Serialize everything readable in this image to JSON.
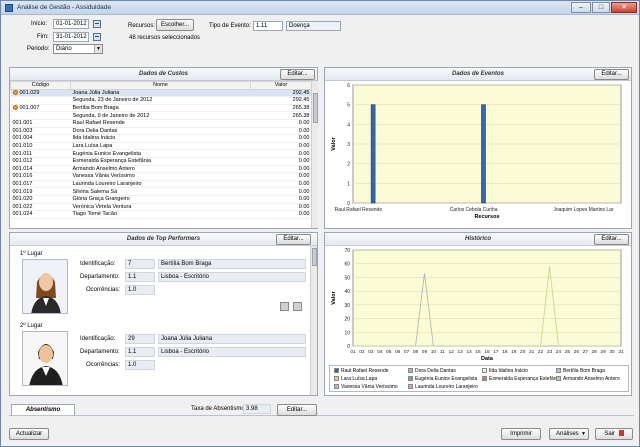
{
  "window": {
    "title": "Análise de Gestão - Assiduidade"
  },
  "filters": {
    "inicio_label": "Início:",
    "inicio_value": "01-01-2012",
    "fim_label": "Fim:",
    "fim_value": "31-01-2012",
    "periodo_label": "Periodo:",
    "periodo_value": "Diário",
    "recursos_label": "Recursos:",
    "escolher_label": "Escolher...",
    "recursos_status": "48 recursos seleccionados",
    "tipo_evento_label": "Tipo de Evento:",
    "tipo_evento_code": "1.11",
    "tipo_evento_name": "Doença"
  },
  "custos": {
    "title": "Dados de Custos",
    "edit_label": "Editar...",
    "columns": [
      "Código",
      "Nome",
      "Valor"
    ],
    "rows": [
      {
        "code": "001.029",
        "name": "Joana Júlia Juliana",
        "value": "292.45",
        "group": true
      },
      {
        "code": "",
        "name": "Segunda, 23 de Janeiro de 2012",
        "value": "292.45",
        "group": false
      },
      {
        "code": "001.007",
        "name": "Bertília Bom Braga",
        "value": "265.38",
        "group": true
      },
      {
        "code": "",
        "name": "Segunda, 9 de Janeiro de 2012",
        "value": "265.38",
        "group": false
      },
      {
        "code": "001.001",
        "name": "Raul Rafael Resende",
        "value": "0.00",
        "group": false
      },
      {
        "code": "001.003",
        "name": "Dora Delia Dantas",
        "value": "0.00",
        "group": false
      },
      {
        "code": "001.004",
        "name": "Ilda Idalina Inácio",
        "value": "0.00",
        "group": false
      },
      {
        "code": "001.010",
        "name": "Lara Luísa Lapa",
        "value": "0.00",
        "group": false
      },
      {
        "code": "001.011",
        "name": "Eugénia Eunice Evangelista",
        "value": "0.00",
        "group": false
      },
      {
        "code": "001.012",
        "name": "Esmeralda Esperança Estefânia",
        "value": "0.00",
        "group": false
      },
      {
        "code": "001.014",
        "name": "Armando Anselmo Antero",
        "value": "0.00",
        "group": false
      },
      {
        "code": "001.016",
        "name": "Vanessa Vânia Veríssimo",
        "value": "0.00",
        "group": false
      },
      {
        "code": "001.017",
        "name": "Laurinda Loureiro Laranjeiro",
        "value": "0.00",
        "group": false
      },
      {
        "code": "001.019",
        "name": "Silvina Salema Sá",
        "value": "0.00",
        "group": false
      },
      {
        "code": "001.020",
        "name": "Glória Graça Grangeiro",
        "value": "0.00",
        "group": false
      },
      {
        "code": "001.022",
        "name": "Verónica Virtela Ventura",
        "value": "0.00",
        "group": false
      },
      {
        "code": "001.024",
        "name": "Tiago Tomé Tacão",
        "value": "0.00",
        "group": false
      }
    ]
  },
  "eventos": {
    "title": "Dados de Eventos",
    "edit_label": "Editar...",
    "ylabel": "Valor",
    "xlabel": "Recursos",
    "yticks": [
      "6",
      "5",
      "4",
      "3",
      "2",
      "1",
      "0"
    ],
    "xcategories": [
      "Raul Rafael Resende",
      "Carlos Cebola Cunha",
      "Joaquim Lopes Martins Lar"
    ]
  },
  "top": {
    "title": "Dados de Top Performers",
    "edit_label": "Editar...",
    "performers": [
      {
        "place": "1º Lugar",
        "id_label": "Identificação:",
        "id": "7",
        "name": "Bertília Bom Braga",
        "dept_label": "Departamento:",
        "dept_code": "1.1",
        "dept_name": "Lisboa - Escritório",
        "occ_label": "Ocorrências:",
        "occ": "1.0"
      },
      {
        "place": "2º Lugar",
        "id_label": "Identificação:",
        "id": "29",
        "name": "Joana Júlia Juliana",
        "dept_label": "Departamento:",
        "dept_code": "1.1",
        "dept_name": "Lisboa - Escritório",
        "occ_label": "Ocorrências:",
        "occ": "1.0"
      }
    ]
  },
  "historico": {
    "title": "Histórico",
    "edit_label": "Editar...",
    "ylabel": "Valor",
    "xlabel": "Data",
    "yticks": [
      "70",
      "60",
      "50",
      "40",
      "30",
      "20",
      "10",
      "0"
    ],
    "legend": [
      {
        "name": "Raul Rafael Resende",
        "color": "#3a5fa8"
      },
      {
        "name": "Dora Delia Dantas",
        "color": "#c9a6c6"
      },
      {
        "name": "Ilda Idalina Inácio",
        "color": "#f5f5cc"
      },
      {
        "name": "Bertília Bom Braga",
        "color": "#a9c4dc"
      },
      {
        "name": "Lara Luísa Lapa",
        "color": "#e8c97a"
      },
      {
        "name": "Eugénia Eunice Evangelista",
        "color": "#6fa0d0"
      },
      {
        "name": "Esmeralda Esperança Estefânia",
        "color": "#d06fa8"
      },
      {
        "name": "Armando Anselmo Antero",
        "color": "#c3d48a"
      },
      {
        "name": "Vanessa Vânia Veríssimo",
        "color": "#c8b0e0"
      },
      {
        "name": "Laurinda Loureiro Laranjeiro",
        "color": "#e6a0a0"
      }
    ]
  },
  "absentismo": {
    "tab_label": "Absentismo",
    "taxa_label": "Taxa de Absentismo",
    "taxa_value": "3.98",
    "edit_label": "Editar..."
  },
  "footer": {
    "atualizar_label": "Actualizar",
    "imprimir_label": "Imprimir",
    "analises_label": "Análises",
    "sair_label": "Sair"
  },
  "chart_data": [
    {
      "type": "bar",
      "title": "Dados de Eventos",
      "xlabel": "Recursos",
      "ylabel": "Valor",
      "ylim": [
        0,
        6
      ],
      "grid": true,
      "categories": [
        "Raul Rafael Resende",
        "",
        "",
        "",
        "",
        "",
        "",
        "Carlos Cebola Cunha",
        "",
        "",
        "",
        "",
        "",
        "",
        "",
        "",
        "Joaquim Lopes Martins Lar"
      ],
      "values": [
        0,
        5,
        0,
        0,
        0,
        0,
        0,
        0,
        5,
        0,
        0,
        0,
        0,
        0,
        0,
        0,
        0
      ]
    },
    {
      "type": "line",
      "title": "Histórico",
      "xlabel": "Data",
      "ylabel": "Valor",
      "ylim": [
        0,
        70
      ],
      "grid": true,
      "x": [
        "01",
        "02",
        "03",
        "04",
        "05",
        "06",
        "07",
        "08",
        "09",
        "10",
        "11",
        "12",
        "13",
        "14",
        "15",
        "16",
        "17",
        "18",
        "19",
        "20",
        "21",
        "22",
        "23",
        "24",
        "25",
        "26",
        "27",
        "28",
        "29",
        "30",
        "31"
      ],
      "series": [
        {
          "name": "Bertília Bom Braga",
          "values": [
            0,
            0,
            0,
            0,
            0,
            0,
            0,
            0,
            53,
            0,
            0,
            0,
            0,
            0,
            0,
            0,
            0,
            0,
            0,
            0,
            0,
            0,
            0,
            0,
            0,
            0,
            0,
            0,
            0,
            0,
            0
          ]
        },
        {
          "name": "Joana Júlia Juliana",
          "values": [
            0,
            0,
            0,
            0,
            0,
            0,
            0,
            0,
            0,
            0,
            0,
            0,
            0,
            0,
            0,
            0,
            0,
            0,
            0,
            0,
            0,
            0,
            58,
            0,
            0,
            0,
            0,
            0,
            0,
            0,
            0
          ]
        }
      ]
    }
  ]
}
